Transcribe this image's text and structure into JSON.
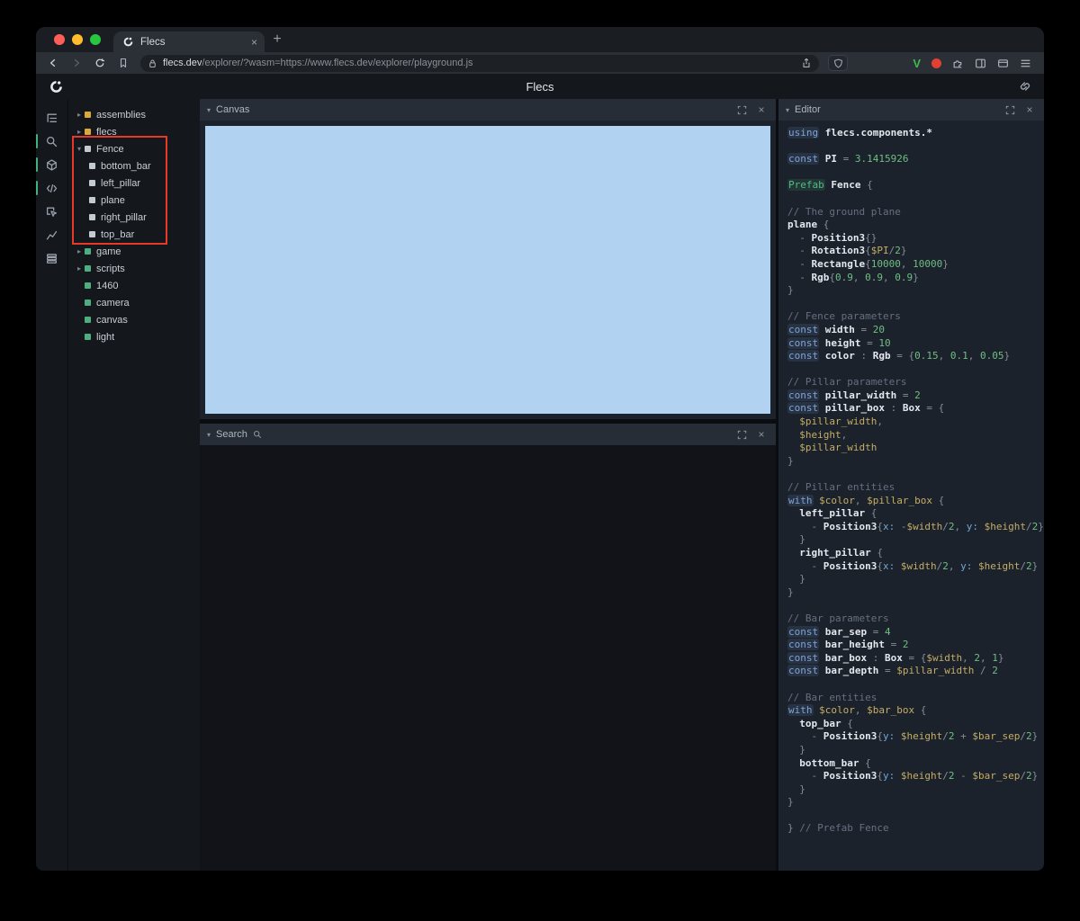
{
  "colors": {
    "accent_green": "#46b07a",
    "square_yellow": "#d9a93c",
    "square_white": "#c2cad2",
    "square_green": "#4fae7f",
    "canvas_blue": "#b2d2f2",
    "highlight_red": "#e8382a"
  },
  "browser": {
    "tab_title": "Flecs",
    "new_tab_label": "+",
    "close_tab_label": "×",
    "url_host": "flecs.dev",
    "url_rest": "/explorer/?wasm=https://www.flecs.dev/explorer/playground.js"
  },
  "app": {
    "title": "Flecs"
  },
  "rail": [
    {
      "id": "entity-tree",
      "active": false
    },
    {
      "id": "search",
      "active": true
    },
    {
      "id": "canvas",
      "active": true
    },
    {
      "id": "editor",
      "active": true
    },
    {
      "id": "inspector",
      "active": false
    },
    {
      "id": "stats",
      "active": false
    },
    {
      "id": "resources",
      "active": false
    }
  ],
  "tree": [
    {
      "label": "assemblies",
      "level": 0,
      "arrow": "collapsed",
      "color": "yellow"
    },
    {
      "label": "flecs",
      "level": 0,
      "arrow": "collapsed",
      "color": "yellow"
    },
    {
      "label": "Fence",
      "level": 0,
      "arrow": "expanded",
      "color": "white"
    },
    {
      "label": "bottom_bar",
      "level": 1,
      "arrow": "none",
      "color": "white"
    },
    {
      "label": "left_pillar",
      "level": 1,
      "arrow": "none",
      "color": "white"
    },
    {
      "label": "plane",
      "level": 1,
      "arrow": "none",
      "color": "white"
    },
    {
      "label": "right_pillar",
      "level": 1,
      "arrow": "none",
      "color": "white"
    },
    {
      "label": "top_bar",
      "level": 1,
      "arrow": "none",
      "color": "white"
    },
    {
      "label": "game",
      "level": 0,
      "arrow": "collapsed",
      "color": "green"
    },
    {
      "label": "scripts",
      "level": 0,
      "arrow": "collapsed",
      "color": "green"
    },
    {
      "label": "1460",
      "level": 0,
      "arrow": "none",
      "color": "green"
    },
    {
      "label": "camera",
      "level": 0,
      "arrow": "none",
      "color": "green"
    },
    {
      "label": "canvas",
      "level": 0,
      "arrow": "none",
      "color": "green"
    },
    {
      "label": "light",
      "level": 0,
      "arrow": "none",
      "color": "green"
    }
  ],
  "panels": {
    "canvas": "Canvas",
    "search": "Search",
    "editor": "Editor",
    "close_label": "×"
  },
  "code": [
    [
      [
        "kw",
        "using"
      ],
      [
        "pl",
        " "
      ],
      [
        "id",
        "flecs.components.*"
      ]
    ],
    [],
    [
      [
        "kw",
        "const"
      ],
      [
        "pl",
        " "
      ],
      [
        "id",
        "PI"
      ],
      [
        "pu",
        " = "
      ],
      [
        "num",
        "3.1415926"
      ]
    ],
    [],
    [
      [
        "kwg",
        "Prefab"
      ],
      [
        "pl",
        " "
      ],
      [
        "id",
        "Fence"
      ],
      [
        "pu",
        " {"
      ]
    ],
    [],
    [
      [
        "cm",
        "// The ground plane"
      ]
    ],
    [
      [
        "id",
        "plane"
      ],
      [
        "pu",
        " {"
      ]
    ],
    [
      [
        "pu",
        "  - "
      ],
      [
        "id",
        "Position3"
      ],
      [
        "pu",
        "{}"
      ]
    ],
    [
      [
        "pu",
        "  - "
      ],
      [
        "id",
        "Rotation3"
      ],
      [
        "pu",
        "{"
      ],
      [
        "va",
        "$PI"
      ],
      [
        "pu",
        "/"
      ],
      [
        "num",
        "2"
      ],
      [
        "pu",
        "}"
      ]
    ],
    [
      [
        "pu",
        "  - "
      ],
      [
        "id",
        "Rectangle"
      ],
      [
        "pu",
        "{"
      ],
      [
        "num",
        "10000"
      ],
      [
        "pu",
        ", "
      ],
      [
        "num",
        "10000"
      ],
      [
        "pu",
        "}"
      ]
    ],
    [
      [
        "pu",
        "  - "
      ],
      [
        "id",
        "Rgb"
      ],
      [
        "pu",
        "{"
      ],
      [
        "num",
        "0.9"
      ],
      [
        "pu",
        ", "
      ],
      [
        "num",
        "0.9"
      ],
      [
        "pu",
        ", "
      ],
      [
        "num",
        "0.9"
      ],
      [
        "pu",
        "}"
      ]
    ],
    [
      [
        "pu",
        "}"
      ]
    ],
    [],
    [
      [
        "cm",
        "// Fence parameters"
      ]
    ],
    [
      [
        "kw",
        "const"
      ],
      [
        "pl",
        " "
      ],
      [
        "id",
        "width"
      ],
      [
        "pu",
        " = "
      ],
      [
        "num",
        "20"
      ]
    ],
    [
      [
        "kw",
        "const"
      ],
      [
        "pl",
        " "
      ],
      [
        "id",
        "height"
      ],
      [
        "pu",
        " = "
      ],
      [
        "num",
        "10"
      ]
    ],
    [
      [
        "kw",
        "const"
      ],
      [
        "pl",
        " "
      ],
      [
        "id",
        "color"
      ],
      [
        "pu",
        " : "
      ],
      [
        "id",
        "Rgb"
      ],
      [
        "pu",
        " = {"
      ],
      [
        "num",
        "0.15"
      ],
      [
        "pu",
        ", "
      ],
      [
        "num",
        "0.1"
      ],
      [
        "pu",
        ", "
      ],
      [
        "num",
        "0.05"
      ],
      [
        "pu",
        "}"
      ]
    ],
    [],
    [
      [
        "cm",
        "// Pillar parameters"
      ]
    ],
    [
      [
        "kw",
        "const"
      ],
      [
        "pl",
        " "
      ],
      [
        "id",
        "pillar_width"
      ],
      [
        "pu",
        " = "
      ],
      [
        "num",
        "2"
      ]
    ],
    [
      [
        "kw",
        "const"
      ],
      [
        "pl",
        " "
      ],
      [
        "id",
        "pillar_box"
      ],
      [
        "pu",
        " : "
      ],
      [
        "id",
        "Box"
      ],
      [
        "pu",
        " = {"
      ]
    ],
    [
      [
        "pl",
        "  "
      ],
      [
        "va",
        "$pillar_width"
      ],
      [
        "pu",
        ","
      ]
    ],
    [
      [
        "pl",
        "  "
      ],
      [
        "va",
        "$height"
      ],
      [
        "pu",
        ","
      ]
    ],
    [
      [
        "pl",
        "  "
      ],
      [
        "va",
        "$pillar_width"
      ]
    ],
    [
      [
        "pu",
        "}"
      ]
    ],
    [],
    [
      [
        "cm",
        "// Pillar entities"
      ]
    ],
    [
      [
        "kw",
        "with"
      ],
      [
        "pl",
        " "
      ],
      [
        "va",
        "$color"
      ],
      [
        "pu",
        ", "
      ],
      [
        "va",
        "$pillar_box"
      ],
      [
        "pu",
        " {"
      ]
    ],
    [
      [
        "pl",
        "  "
      ],
      [
        "id",
        "left_pillar"
      ],
      [
        "pu",
        " {"
      ]
    ],
    [
      [
        "pu",
        "    - "
      ],
      [
        "id",
        "Position3"
      ],
      [
        "pu",
        "{"
      ],
      [
        "mb",
        "x:"
      ],
      [
        "pl",
        " "
      ],
      [
        "pu",
        "-"
      ],
      [
        "va",
        "$width"
      ],
      [
        "pu",
        "/"
      ],
      [
        "num",
        "2"
      ],
      [
        "pu",
        ", "
      ],
      [
        "mb",
        "y:"
      ],
      [
        "pl",
        " "
      ],
      [
        "va",
        "$height"
      ],
      [
        "pu",
        "/"
      ],
      [
        "num",
        "2"
      ],
      [
        "pu",
        "}"
      ]
    ],
    [
      [
        "pu",
        "  }"
      ]
    ],
    [
      [
        "pl",
        "  "
      ],
      [
        "id",
        "right_pillar"
      ],
      [
        "pu",
        " {"
      ]
    ],
    [
      [
        "pu",
        "    - "
      ],
      [
        "id",
        "Position3"
      ],
      [
        "pu",
        "{"
      ],
      [
        "mb",
        "x:"
      ],
      [
        "pl",
        " "
      ],
      [
        "va",
        "$width"
      ],
      [
        "pu",
        "/"
      ],
      [
        "num",
        "2"
      ],
      [
        "pu",
        ", "
      ],
      [
        "mb",
        "y:"
      ],
      [
        "pl",
        " "
      ],
      [
        "va",
        "$height"
      ],
      [
        "pu",
        "/"
      ],
      [
        "num",
        "2"
      ],
      [
        "pu",
        "}"
      ]
    ],
    [
      [
        "pu",
        "  }"
      ]
    ],
    [
      [
        "pu",
        "}"
      ]
    ],
    [],
    [
      [
        "cm",
        "// Bar parameters"
      ]
    ],
    [
      [
        "kw",
        "const"
      ],
      [
        "pl",
        " "
      ],
      [
        "id",
        "bar_sep"
      ],
      [
        "pu",
        " = "
      ],
      [
        "num",
        "4"
      ]
    ],
    [
      [
        "kw",
        "const"
      ],
      [
        "pl",
        " "
      ],
      [
        "id",
        "bar_height"
      ],
      [
        "pu",
        " = "
      ],
      [
        "num",
        "2"
      ]
    ],
    [
      [
        "kw",
        "const"
      ],
      [
        "pl",
        " "
      ],
      [
        "id",
        "bar_box"
      ],
      [
        "pu",
        " : "
      ],
      [
        "id",
        "Box"
      ],
      [
        "pu",
        " = {"
      ],
      [
        "va",
        "$width"
      ],
      [
        "pu",
        ", "
      ],
      [
        "num",
        "2"
      ],
      [
        "pu",
        ", "
      ],
      [
        "num",
        "1"
      ],
      [
        "pu",
        "}"
      ]
    ],
    [
      [
        "kw",
        "const"
      ],
      [
        "pl",
        " "
      ],
      [
        "id",
        "bar_depth"
      ],
      [
        "pu",
        " = "
      ],
      [
        "va",
        "$pillar_width"
      ],
      [
        "pu",
        " / "
      ],
      [
        "num",
        "2"
      ]
    ],
    [],
    [
      [
        "cm",
        "// Bar entities"
      ]
    ],
    [
      [
        "kw",
        "with"
      ],
      [
        "pl",
        " "
      ],
      [
        "va",
        "$color"
      ],
      [
        "pu",
        ", "
      ],
      [
        "va",
        "$bar_box"
      ],
      [
        "pu",
        " {"
      ]
    ],
    [
      [
        "pl",
        "  "
      ],
      [
        "id",
        "top_bar"
      ],
      [
        "pu",
        " {"
      ]
    ],
    [
      [
        "pu",
        "    - "
      ],
      [
        "id",
        "Position3"
      ],
      [
        "pu",
        "{"
      ],
      [
        "mb",
        "y:"
      ],
      [
        "pl",
        " "
      ],
      [
        "va",
        "$height"
      ],
      [
        "pu",
        "/"
      ],
      [
        "num",
        "2"
      ],
      [
        "pu",
        " + "
      ],
      [
        "va",
        "$bar_sep"
      ],
      [
        "pu",
        "/"
      ],
      [
        "num",
        "2"
      ],
      [
        "pu",
        "}"
      ]
    ],
    [
      [
        "pu",
        "  }"
      ]
    ],
    [
      [
        "pl",
        "  "
      ],
      [
        "id",
        "bottom_bar"
      ],
      [
        "pu",
        " {"
      ]
    ],
    [
      [
        "pu",
        "    - "
      ],
      [
        "id",
        "Position3"
      ],
      [
        "pu",
        "{"
      ],
      [
        "mb",
        "y:"
      ],
      [
        "pl",
        " "
      ],
      [
        "va",
        "$height"
      ],
      [
        "pu",
        "/"
      ],
      [
        "num",
        "2"
      ],
      [
        "pu",
        " - "
      ],
      [
        "va",
        "$bar_sep"
      ],
      [
        "pu",
        "/"
      ],
      [
        "num",
        "2"
      ],
      [
        "pu",
        "}"
      ]
    ],
    [
      [
        "pu",
        "  }"
      ]
    ],
    [
      [
        "pu",
        "}"
      ]
    ],
    [],
    [
      [
        "pu",
        "} "
      ],
      [
        "cm",
        "// Prefab Fence"
      ]
    ]
  ]
}
